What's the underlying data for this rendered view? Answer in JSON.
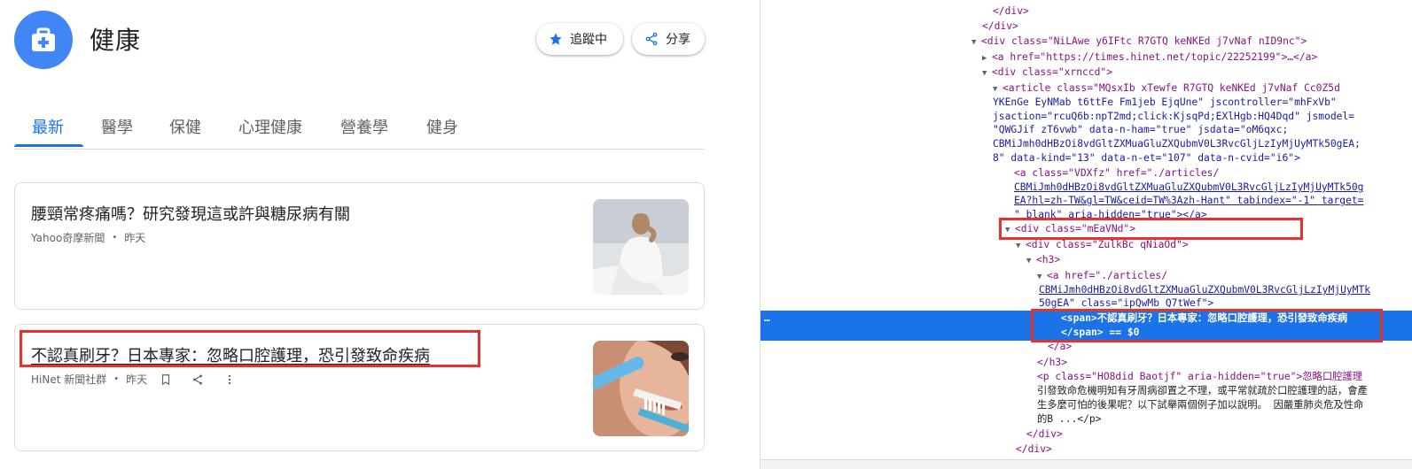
{
  "colors": {
    "accent": "#1a73e8",
    "icon_bg": "#4285f4",
    "highlight_box": "#e8312c"
  },
  "header": {
    "icon": "medical-kit-icon",
    "title": "健康",
    "follow_label": "追蹤中",
    "follow_icon": "star-icon",
    "share_label": "分享",
    "share_icon": "share-icon"
  },
  "tabs": [
    {
      "label": "最新",
      "active": true
    },
    {
      "label": "醫學",
      "active": false
    },
    {
      "label": "保健",
      "active": false
    },
    {
      "label": "心理健康",
      "active": false
    },
    {
      "label": "營養學",
      "active": false
    },
    {
      "label": "健身",
      "active": false
    }
  ],
  "articles": [
    {
      "headline": "腰頸常疼痛嗎？研究發現這或許與糖尿病有關",
      "source": "Yahoo奇摩新聞",
      "separator": "•",
      "time": "昨天"
    },
    {
      "headline": "不認真刷牙？日本專家：忽略口腔護理，恐引發致命疾病",
      "source": "HiNet 新聞社群",
      "separator": "•",
      "time": "昨天"
    }
  ],
  "devtools": {
    "lines": [
      "</div>",
      "</div>",
      "<div class=\"NiLAwe y6IFtc R7GTQ keNKEd j7vNaf nID9nc\">",
      "<a href=\"https://times.hinet.net/topic/22252199\">…</a>",
      "<div class=\"xrnccd\">",
      "<article class=\"MQsxIb xTewfe R7GTQ keNKEd j7vNaf Cc0Z5d",
      "YKEnGe EyNMab t6ttFe Fm1jeb EjqUne\" jscontroller=\"mhFxVb\"",
      "jsaction=\"rcuQ6b:npT2md;click:KjsqPd;EXlHgb:HQ4Dqd\" jsmodel=",
      "\"QWGJif zT6vwb\" data-n-ham=\"true\" jsdata=\"oM6qxc;",
      "CBMiJmh0dHBzOi8vdGltZXMuaGluZXQubmV0L3RvcGljLzIyMjUyMTk50gEA;",
      "8\" data-kind=\"13\" data-n-et=\"107\" data-n-cvid=\"i6\">",
      "<a class=\"VDXfz\" href=\"./articles/",
      "CBMiJmh0dHBzOi8vdGltZXMuaGluZXQubmV0L3RvcGljLzIyMjUyMTk50g",
      "EA?hl=zh-TW&gl=TW&ceid=TW%3Azh-Hant\" tabindex=\"-1\" target=",
      "\"_blank\" aria-hidden=\"true\"></a>",
      "<div class=\"mEaVNd\">",
      "<div class=\"ZulkBc qNiaOd\">",
      "<h3>",
      "<a href=\"./articles/",
      "CBMiJmh0dHBzOi8vdGltZXMuaGluZXQubmV0L3RvcGljLzIyMjUyMTk",
      "50gEA\" class=\"ipQwMb Q7tWef\">",
      "<span>不認真刷牙？日本專家：忽略口腔護理，恐引發致命疾病",
      "</span> == $0",
      "</a>",
      "</h3>",
      "<p class=\"HO8did Baotjf\" aria-hidden=\"true\">忽略口腔護理",
      "引發致命危機明知有牙周病卻置之不理，或平常就疏於口腔護理的話，會產",
      "生多麼可怕的後果呢？以下試舉兩個例子加以說明。 因嚴重肺炎危及性命",
      "的B ...</p>",
      "</div>",
      "</div>"
    ]
  }
}
